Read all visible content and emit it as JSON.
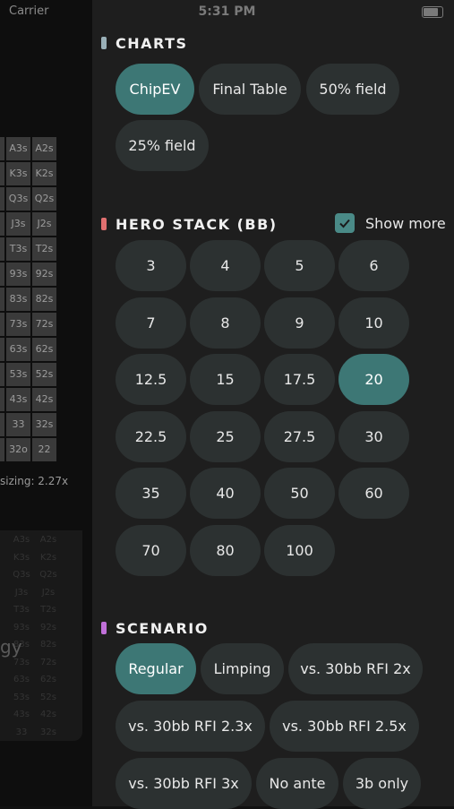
{
  "status_bar": {
    "carrier": "Carrier",
    "time": "5:31 PM"
  },
  "background": {
    "grid_rows": [
      [
        "s",
        "A3s",
        "A2s"
      ],
      [
        "s",
        "K3s",
        "K2s"
      ],
      [
        "s",
        "Q3s",
        "Q2s"
      ],
      [
        "s",
        "J3s",
        "J2s"
      ],
      [
        "s",
        "T3s",
        "T2s"
      ],
      [
        "s",
        "93s",
        "92s"
      ],
      [
        "s",
        "83s",
        "82s"
      ],
      [
        "s",
        "73s",
        "72s"
      ],
      [
        "s",
        "63s",
        "62s"
      ],
      [
        "s",
        "53s",
        "52s"
      ],
      [
        "s",
        "43s",
        "42s"
      ],
      [
        "o",
        "33",
        "32s"
      ],
      [
        "o",
        "32o",
        "22"
      ]
    ],
    "sizing_text": "sizing: 2.27x",
    "faded_grid_rows": [
      [
        "s",
        "A3s",
        "A2s"
      ],
      [
        "s",
        "K3s",
        "K2s"
      ],
      [
        "s",
        "Q3s",
        "Q2s"
      ],
      [
        "s",
        "J3s",
        "J2s"
      ],
      [
        "s",
        "T3s",
        "T2s"
      ],
      [
        "s",
        "93s",
        "92s"
      ],
      [
        "s",
        "83s",
        "82s"
      ],
      [
        "s",
        "73s",
        "72s"
      ],
      [
        "s",
        "63s",
        "62s"
      ],
      [
        "s",
        "53s",
        "52s"
      ],
      [
        "s",
        "43s",
        "42s"
      ],
      [
        "o",
        "33",
        "32s"
      ]
    ],
    "partial_word": "gy"
  },
  "charts": {
    "title": "CHARTS",
    "accent": "#9ab0b8",
    "options": [
      {
        "label": "ChipEV",
        "selected": true
      },
      {
        "label": "Final Table",
        "selected": false
      },
      {
        "label": "50% field",
        "selected": false
      },
      {
        "label": "25% field",
        "selected": false
      }
    ]
  },
  "hero_stack": {
    "title": "HERO STACK (BB)",
    "accent": "#e07070",
    "show_more_label": "Show more",
    "show_more_checked": true,
    "options": [
      {
        "label": "3",
        "selected": false
      },
      {
        "label": "4",
        "selected": false
      },
      {
        "label": "5",
        "selected": false
      },
      {
        "label": "6",
        "selected": false
      },
      {
        "label": "7",
        "selected": false
      },
      {
        "label": "8",
        "selected": false
      },
      {
        "label": "9",
        "selected": false
      },
      {
        "label": "10",
        "selected": false
      },
      {
        "label": "12.5",
        "selected": false
      },
      {
        "label": "15",
        "selected": false
      },
      {
        "label": "17.5",
        "selected": false
      },
      {
        "label": "20",
        "selected": true
      },
      {
        "label": "22.5",
        "selected": false
      },
      {
        "label": "25",
        "selected": false
      },
      {
        "label": "27.5",
        "selected": false
      },
      {
        "label": "30",
        "selected": false
      },
      {
        "label": "35",
        "selected": false
      },
      {
        "label": "40",
        "selected": false
      },
      {
        "label": "50",
        "selected": false
      },
      {
        "label": "60",
        "selected": false
      },
      {
        "label": "70",
        "selected": false
      },
      {
        "label": "80",
        "selected": false
      },
      {
        "label": "100",
        "selected": false
      }
    ]
  },
  "scenario": {
    "title": "SCENARIO",
    "accent": "#c070d8",
    "options": [
      {
        "label": "Regular",
        "selected": true
      },
      {
        "label": "Limping",
        "selected": false
      },
      {
        "label": "vs. 30bb RFI 2x",
        "selected": false
      },
      {
        "label": "vs. 30bb RFI 2.3x",
        "selected": false
      },
      {
        "label": "vs. 30bb RFI 2.5x",
        "selected": false
      },
      {
        "label": "vs. 30bb RFI 3x",
        "selected": false
      },
      {
        "label": "No ante",
        "selected": false
      },
      {
        "label": "3b only",
        "selected": false
      }
    ]
  }
}
